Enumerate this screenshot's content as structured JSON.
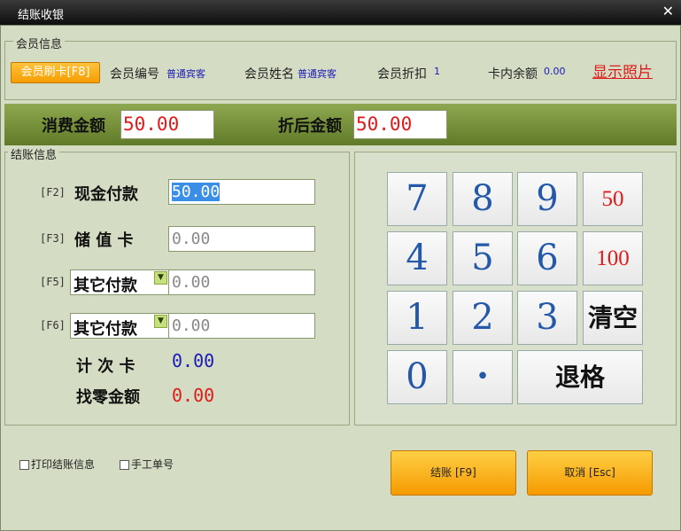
{
  "window": {
    "title": "结账收银",
    "close_glyph": "✕"
  },
  "member": {
    "legend": "会员信息",
    "swipe_button": "会员刷卡[F8]",
    "id_label": "会员编号",
    "id_value": "普通宾客",
    "name_label": "会员姓名",
    "name_value": "普通宾客",
    "discount_label": "会员折扣",
    "discount_value": "1",
    "balance_label": "卡内余额",
    "balance_value": "0.00",
    "photo_link": "显示照片"
  },
  "amounts": {
    "consume_label": "消费金额",
    "consume_value": "50.00",
    "discounted_label": "折后金额",
    "discounted_value": "50.00"
  },
  "settle": {
    "legend": "结账信息",
    "cash_key": "[F2]",
    "cash_label": "现金付款",
    "cash_value": "50.00",
    "stored_key": "[F3]",
    "stored_label": "储 值 卡",
    "stored_value": "0.00",
    "other1_key": "[F5]",
    "other1_label": "其它付款",
    "other1_value": "0.00",
    "other2_key": "[F6]",
    "other2_label": "其它付款",
    "other2_value": "0.00",
    "count_card_label": "计 次 卡",
    "count_card_value": "0.00",
    "change_label": "找零金额",
    "change_value": "0.00"
  },
  "keypad": {
    "k7": "7",
    "k8": "8",
    "k9": "9",
    "k50": "50",
    "k4": "4",
    "k5": "5",
    "k6": "6",
    "k100": "100",
    "k1": "1",
    "k2": "2",
    "k3": "3",
    "clear": "清空",
    "k0": "0",
    "dot": "•",
    "backspace": "退格"
  },
  "options": {
    "print_label": "打印结账信息",
    "manual_label": "手工单号"
  },
  "actions": {
    "confirm_label": "结账 [F9]",
    "cancel_label": "取消 [Esc]"
  },
  "colors": {
    "accent_orange": "#f5a200",
    "value_red": "#e01a1a",
    "value_blue": "#1a1ab8",
    "bar_green": "#6e8a2e"
  }
}
